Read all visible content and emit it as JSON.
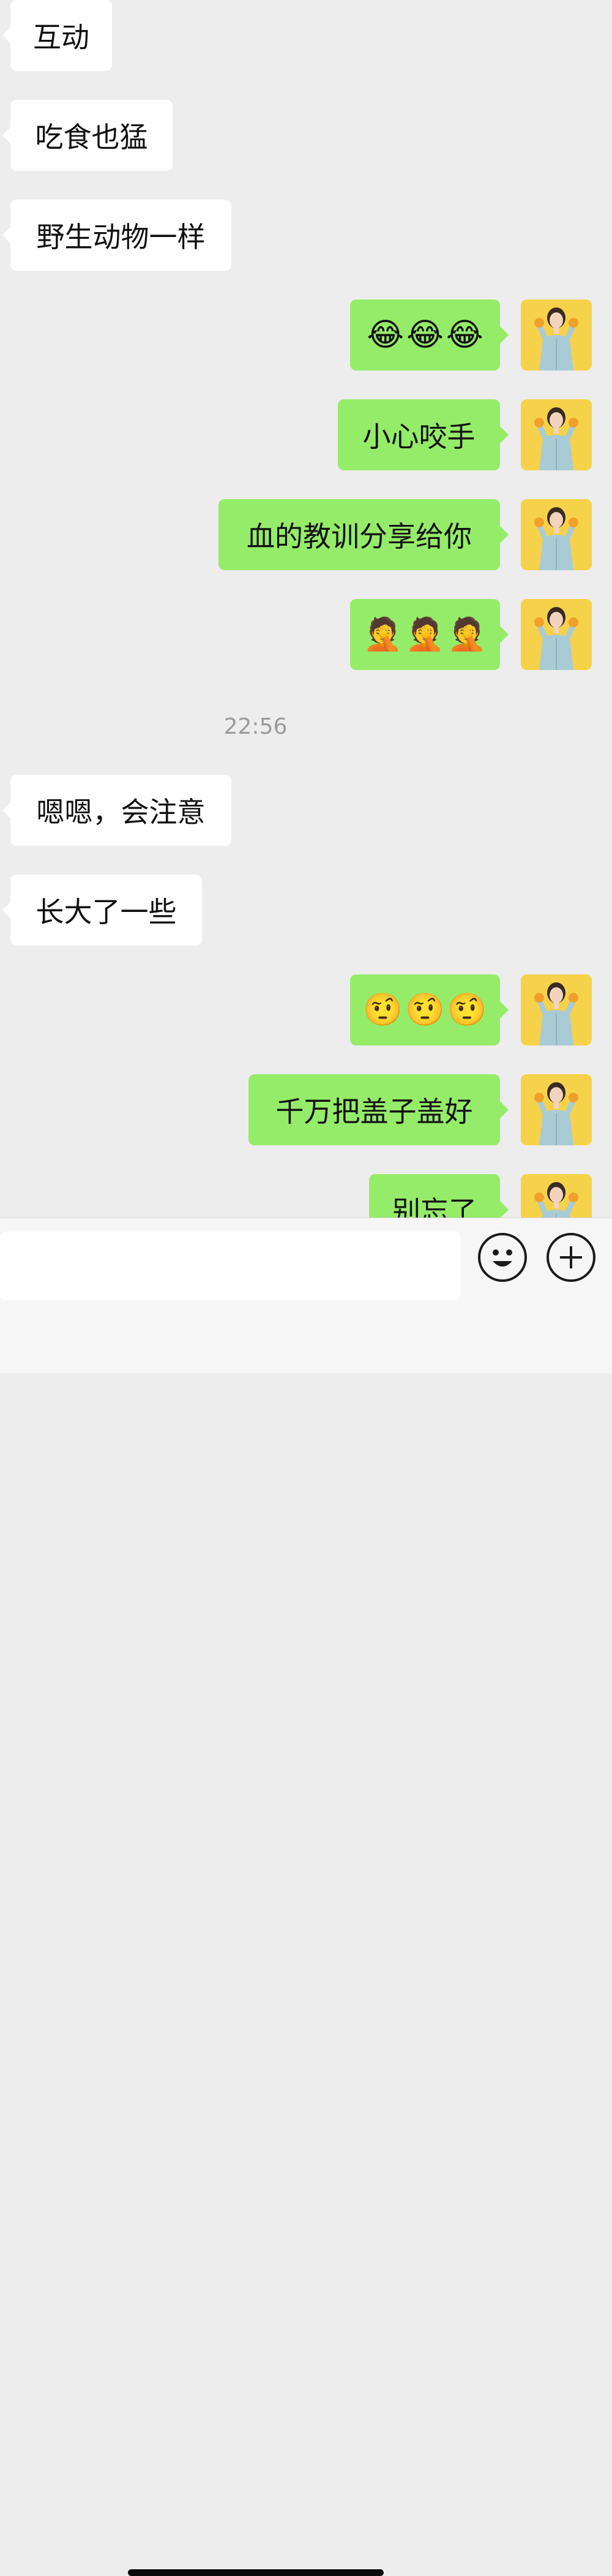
{
  "messages": [
    {
      "side": "in",
      "text": "互动"
    },
    {
      "side": "in",
      "text": "吃食也猛"
    },
    {
      "side": "in",
      "text": "野生动物一样"
    },
    {
      "side": "out",
      "emoji": [
        "😂",
        "😂",
        "😂"
      ],
      "emoji_name": "tears-of-joy-emoji"
    },
    {
      "side": "out",
      "text": "小心咬手"
    },
    {
      "side": "out",
      "text": "血的教训分享给你"
    },
    {
      "side": "out",
      "emoji": [
        "🤦",
        "🤦",
        "🤦"
      ],
      "emoji_name": "facepalm-emoji"
    },
    {
      "side": "in",
      "text": "嗯嗯，会注意"
    },
    {
      "side": "in",
      "text": "长大了一些"
    },
    {
      "side": "out",
      "emoji": [
        "🤨",
        "🤨",
        "🤨"
      ],
      "emoji_name": "skeptical-emoji"
    },
    {
      "side": "out",
      "text": "千万把盖子盖好"
    },
    {
      "side": "out",
      "text": "别忘了"
    }
  ],
  "timestamp": "22:56",
  "input": {
    "value": "",
    "placeholder": ""
  },
  "icons": {
    "emoji_button": "smiley-icon",
    "more_button": "plus-icon"
  },
  "colors": {
    "background": "#ededed",
    "incoming_bubble": "#ffffff",
    "outgoing_bubble": "#95ec69",
    "avatar_bg": "#f6d24a"
  }
}
